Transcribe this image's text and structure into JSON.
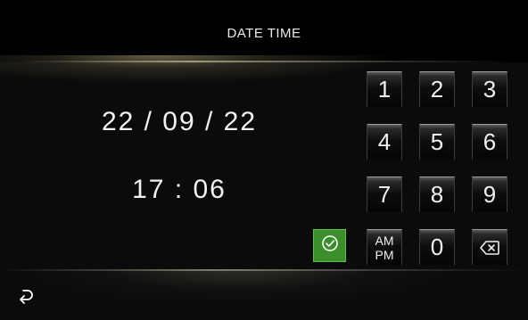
{
  "header": {
    "title": "DATE TIME"
  },
  "fields": {
    "date": "22 / 09 / 22",
    "time": "17 : 06"
  },
  "keypad": {
    "k1": "1",
    "k2": "2",
    "k3": "3",
    "k4": "4",
    "k5": "5",
    "k6": "6",
    "k7": "7",
    "k8": "8",
    "k9": "9",
    "ampm_top": "AM",
    "ampm_bottom": "PM",
    "k0": "0"
  },
  "icons": {
    "confirm": "check-circle-icon",
    "backspace": "backspace-icon",
    "back": "return-arrow-icon"
  },
  "colors": {
    "confirm_green": "#3b8e2a",
    "background": "#000000"
  }
}
